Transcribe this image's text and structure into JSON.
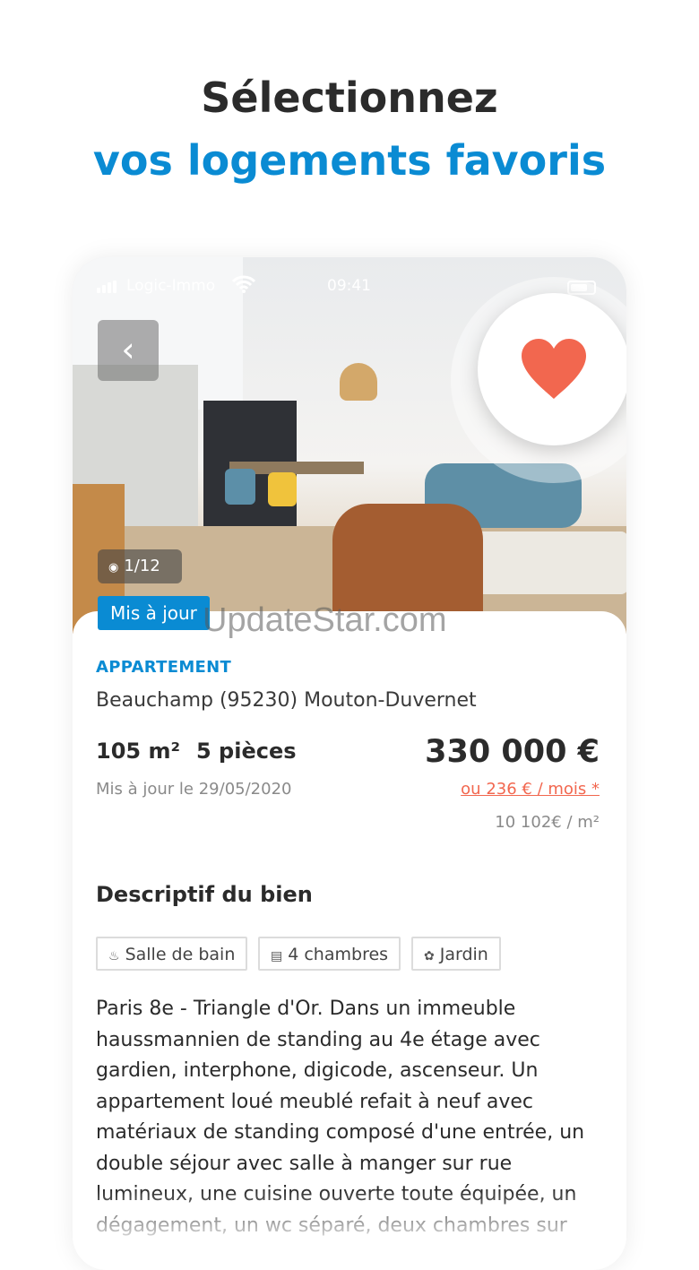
{
  "headline": {
    "line1": "Sélectionnez",
    "line2": "vos logements favoris"
  },
  "status_bar": {
    "carrier": "Logic-Immo",
    "time": "09:41"
  },
  "photo": {
    "counter": "1/12"
  },
  "listing": {
    "badge": "Mis à jour",
    "watermark": "UpdateStar.com",
    "type": "APPARTEMENT",
    "address": "Beauchamp (95230) Mouton-Duvernet",
    "surface": "105 m²",
    "rooms": "5 pièces",
    "updated": "Mis à jour le 29/05/2020",
    "price": "330 000 €",
    "monthly": "ou 236 € / mois *",
    "price_per_sqm": "10 102€ / m²"
  },
  "description": {
    "title": "Descriptif du bien",
    "tags": [
      "Salle de bain",
      "4 chambres",
      "Jardin"
    ],
    "text": "Paris 8e - Triangle d'Or. Dans un immeuble haussmannien de standing au 4e étage avec gardien, interphone, digicode, ascenseur. Un appartement loué meublé refait à neuf avec matériaux de standing composé d'une entrée, un double séjour avec salle à manger sur rue lumineux, une cuisine ouverte toute équipée, un dégagement, un wc séparé, deux chambres sur"
  },
  "colors": {
    "accent": "#0a8bd3",
    "heart": "#f2674f",
    "text": "#2b2b2b"
  },
  "icons": [
    "back-icon",
    "camera-icon",
    "heart-icon",
    "bath-icon",
    "bed-icon",
    "garden-icon",
    "wifi-icon",
    "battery-icon"
  ]
}
